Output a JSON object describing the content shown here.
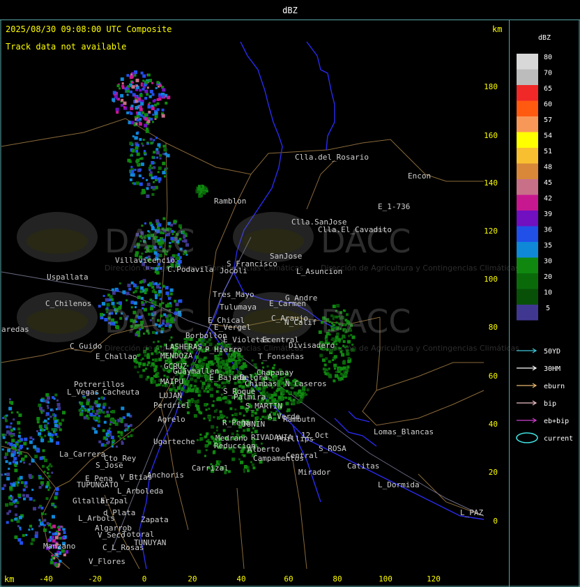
{
  "window": {
    "title": "dBZ"
  },
  "header": {
    "timestamp": "2025/08/30 09:08:00 UTC Composite",
    "track_message": "Track data not available",
    "km_unit_top": "km",
    "km_unit_bottom": "km"
  },
  "axes": {
    "x_ticks": [
      "-40",
      "-20",
      "0",
      "20",
      "40",
      "60",
      "80",
      "100",
      "120"
    ],
    "y_ticks": [
      "180",
      "160",
      "140",
      "120",
      "100",
      "80",
      "60",
      "40",
      "20",
      "0"
    ]
  },
  "legend": {
    "title": "dBZ",
    "entries": [
      {
        "label": "80",
        "color": "#d8d8d8"
      },
      {
        "label": "70",
        "color": "#bcbcbc"
      },
      {
        "label": "65",
        "color": "#f02828"
      },
      {
        "label": "60",
        "color": "#ff5a10"
      },
      {
        "label": "57",
        "color": "#f89858"
      },
      {
        "label": "54",
        "color": "#ffff00"
      },
      {
        "label": "51",
        "color": "#f8c030"
      },
      {
        "label": "48",
        "color": "#d88838"
      },
      {
        "label": "45",
        "color": "#c87088"
      },
      {
        "label": "42",
        "color": "#c81890"
      },
      {
        "label": "39",
        "color": "#7010c0"
      },
      {
        "label": "36",
        "color": "#2050e8"
      },
      {
        "label": "35",
        "color": "#1088d8"
      },
      {
        "label": "30",
        "color": "#108810"
      },
      {
        "label": "20",
        "color": "#0a6a0a"
      },
      {
        "label": "10",
        "color": "#085008"
      },
      {
        "label": "5",
        "color": "#403890"
      }
    ],
    "tracks": [
      {
        "label": "50YD",
        "color": "#40c8d8"
      },
      {
        "label": "30HM",
        "color": "#ffffff"
      },
      {
        "label": "eburn",
        "color": "#e8b870"
      },
      {
        "label": "bip",
        "color": "#f0c0c8"
      },
      {
        "label": "eb+bip",
        "color": "#d040d0"
      }
    ],
    "current_label": "current",
    "current_color": "#40e0e0"
  },
  "watermarks": [
    {
      "brand": "DACC",
      "subtitle": "Dirección de Agricultura y Contingencias Climáticas"
    },
    {
      "brand": "DACC",
      "subtitle": "Dirección de Agricultura y Contingencias Climáticas"
    },
    {
      "brand": "DACC",
      "subtitle": "Dirección de Agricultura y Contingencias Climáticas"
    },
    {
      "brand": "DACC",
      "subtitle": "Dirección de Agricultura y Contingencias Climáticas"
    }
  ],
  "places": [
    "Clla.del_Rosario",
    "Encon",
    "E_1-736",
    "Ramblon",
    "Clla.SanJose",
    "Clla.El_Cavadito",
    "Villavicencio",
    "Uspallata",
    "C.Podavila",
    "S_Francisco",
    "Jocoli",
    "SanJose",
    "L_Asuncion",
    "C_Chilenos",
    "Tres_Mayo",
    "Tulumaya",
    "E_Carmen",
    "G_Andre",
    "aredas",
    "E_Chical",
    "E_Vergel",
    "C_Araujo",
    "N_Calif",
    "Borbollon",
    "E_Violetas",
    "Ecentral",
    "Divisadero",
    "C_Guido",
    "E_Challao",
    "LASHERAS",
    "P_Hierro",
    "MENDOZA",
    "T_Fonseñas",
    "GCRUZ",
    "Guaymallen",
    "Chapanay",
    "E_Bajada",
    "Potrerillos",
    "Cacheuta",
    "MAIPU",
    "Belgra",
    "Chimbas",
    "N_Caseros",
    "L_Vegas",
    "LUJAN",
    "S_Roque",
    "Palmira",
    "Perdriel",
    "S_MARTIN",
    "Agrelo",
    "R_Peña",
    "JUNIN",
    "A_Verde",
    "Rambutn",
    "Ugarteche",
    "Medrano",
    "Reduccion",
    "RIVADAVIA",
    "Phillips",
    "12_Oct",
    "Lomas_Blancas",
    "La_Carrera",
    "Cto_Rey",
    "S_Jose",
    "Carrizal",
    "Alberto",
    "S_ROSA",
    "Campamentos",
    "Central",
    "Catitas",
    "E_Pena",
    "V_Btias",
    "Anchoris",
    "TUPUNGATO",
    "L_Arboleda",
    "Mirador",
    "L_Dormida",
    "Gltallar",
    "E_Zpal",
    "L_Arbols",
    "d_Plata",
    "Zapata",
    "L_PAZ",
    "Algarrob",
    "V_Seco",
    "Totoral",
    "TUNUYAN",
    "Manzano",
    "C_L_Rosas",
    "V_Flores"
  ]
}
